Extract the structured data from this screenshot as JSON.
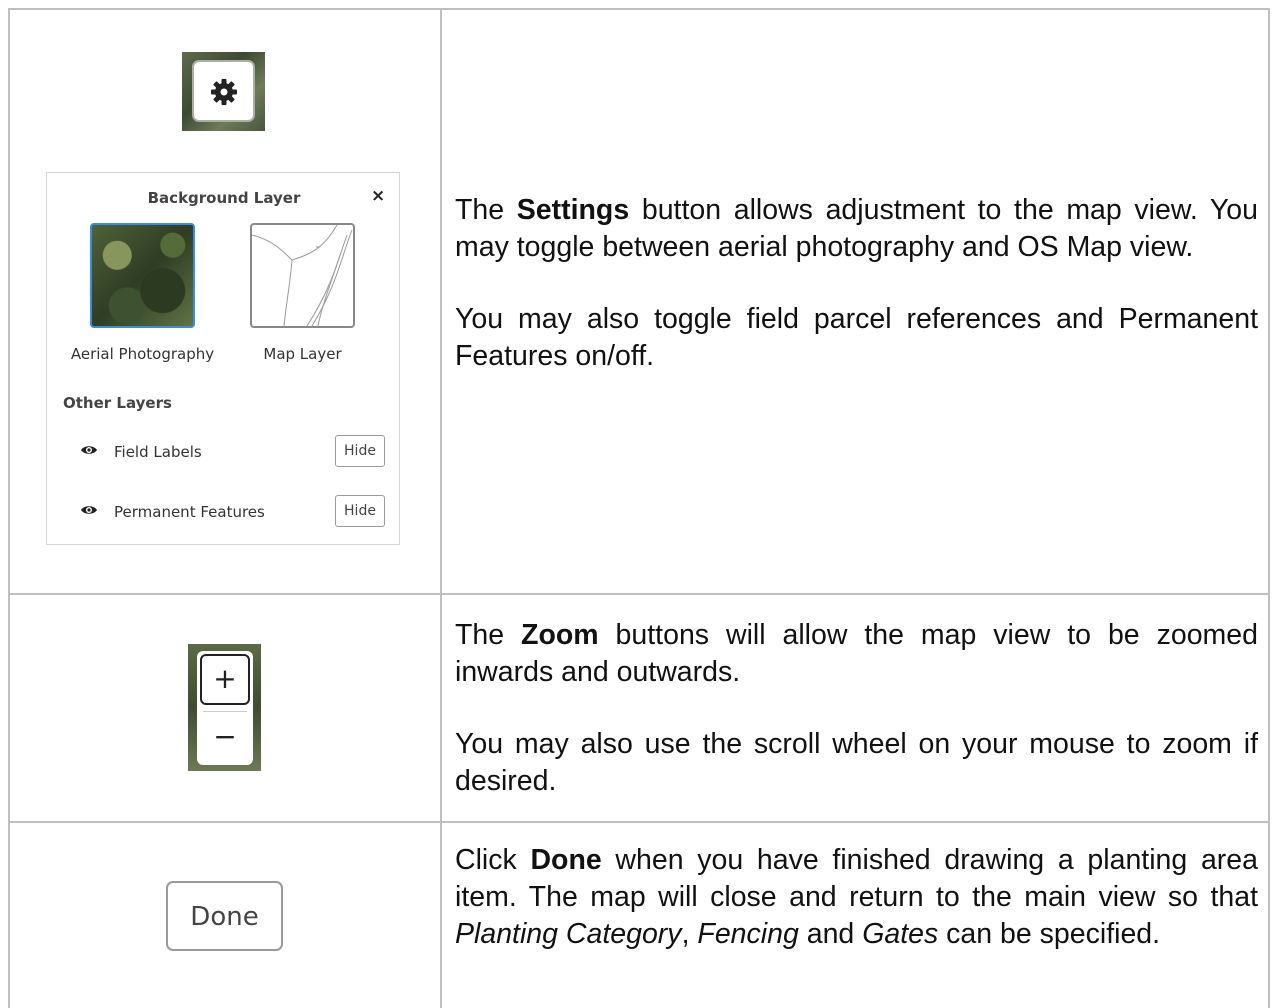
{
  "row1": {
    "panel": {
      "title": "Background Layer",
      "close": "×",
      "aerial_label": "Aerial Photography",
      "map_label": "Map Layer",
      "other_layers": "Other Layers",
      "layers": [
        {
          "label": "Field Labels",
          "button": "Hide"
        },
        {
          "label": "Permanent Features",
          "button": "Hide"
        }
      ]
    },
    "text": {
      "p1_pre": "The ",
      "p1_bold": "Settings",
      "p1_post": " button allows adjustment to the map view. You may toggle between aerial photography and OS Map view.",
      "p2": "You may also toggle field parcel references and Permanent Features on/off."
    }
  },
  "row2": {
    "zoom_in": "+",
    "zoom_out": "−",
    "text": {
      "p1_pre": "The ",
      "p1_bold": "Zoom",
      "p1_post": " buttons will allow the map view to be zoomed inwards and outwards.",
      "p2": "You may also use the scroll wheel on your mouse to zoom if desired."
    }
  },
  "row3": {
    "done_label": "Done",
    "text": {
      "p1_pre": "Click ",
      "p1_bold": "Done",
      "p1_mid1": " when you have finished drawing a planting area item.  The map will close and return to the main view so that ",
      "p1_ital1": "Planting Category",
      "p1_sep1": ", ",
      "p1_ital2": "Fencing",
      "p1_sep2": " and ",
      "p1_ital3": "Gates",
      "p1_end": " can be specified."
    }
  },
  "colors": {
    "border": "#bfbfbf",
    "selected": "#3a8dd8"
  }
}
